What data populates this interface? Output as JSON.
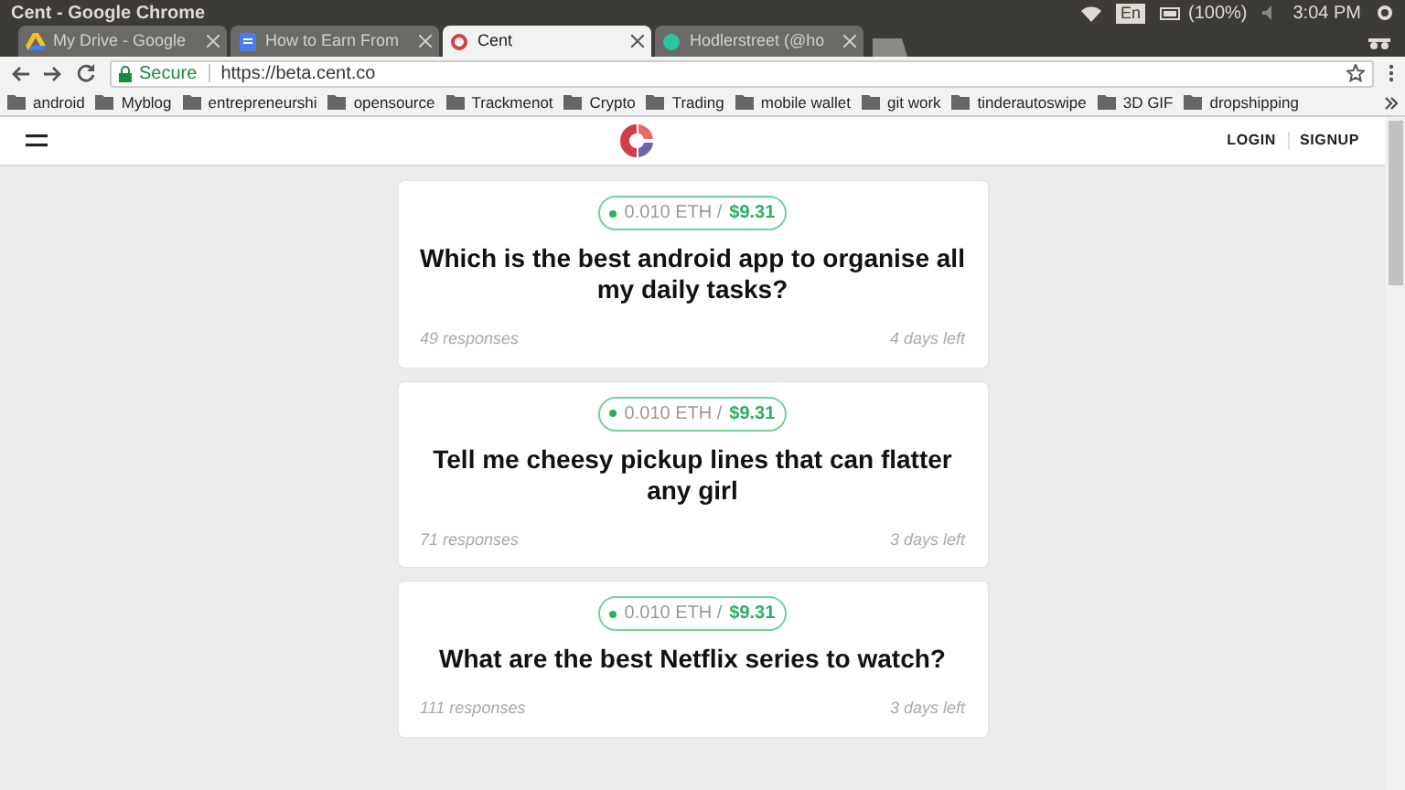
{
  "window": {
    "title": "Cent - Google Chrome"
  },
  "system_tray": {
    "keyboard": "En",
    "battery": "(100%)",
    "time": "3:04 PM"
  },
  "tabs": [
    {
      "label": "My Drive - Google",
      "selected": false,
      "kind": "drive"
    },
    {
      "label": "How to Earn From",
      "selected": false,
      "kind": "doc"
    },
    {
      "label": "Cent",
      "selected": true,
      "kind": "cent"
    },
    {
      "label": "Hodlerstreet (@ho",
      "selected": false,
      "kind": "globe"
    }
  ],
  "address_bar": {
    "secure_label": "Secure",
    "url": "https://beta.cent.co"
  },
  "bookmarks": [
    "android",
    "Myblog",
    "entrepreneurshi",
    "opensource",
    "Trackmenot",
    "Crypto",
    "Trading",
    "mobile wallet",
    "git work",
    "tinderautoswipe",
    "3D GIF",
    "dropshipping"
  ],
  "header": {
    "links": [
      "LOGIN",
      "SIGNUP"
    ]
  },
  "questions": [
    {
      "eth": "0.010 ETH /",
      "usd": "$9.31",
      "title": "Which is the best android app to organise all my daily tasks?",
      "responses": "49 responses",
      "time_left": "4 days left"
    },
    {
      "eth": "0.010 ETH /",
      "usd": "$9.31",
      "title": "Tell me cheesy pickup lines that can flatter any girl",
      "responses": "71 responses",
      "time_left": "3 days left"
    },
    {
      "eth": "0.010 ETH /",
      "usd": "$9.31",
      "title": "What are the best Netflix series to watch?",
      "responses": "111 responses",
      "time_left": "3 days left"
    }
  ]
}
